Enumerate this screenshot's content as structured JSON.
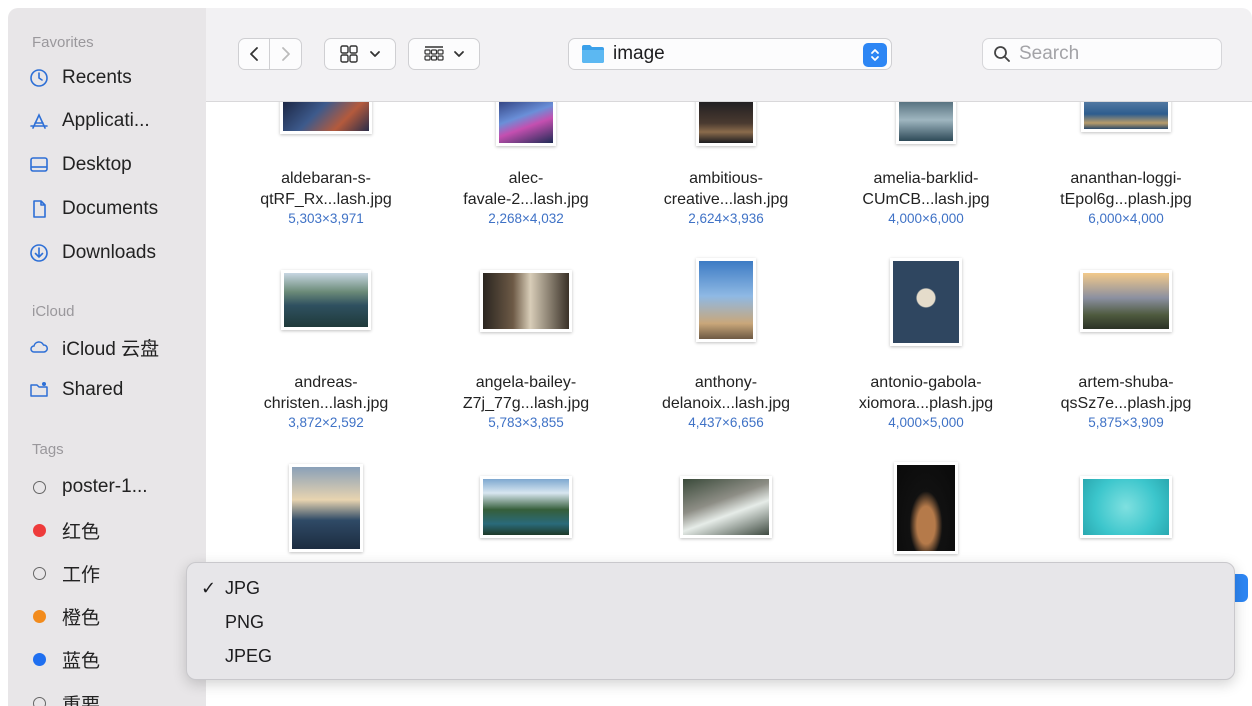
{
  "sidebar": {
    "favorites_label": "Favorites",
    "favorites": [
      {
        "label": "Recents",
        "icon": "clock-icon"
      },
      {
        "label": "Applicati...",
        "icon": "applications-icon"
      },
      {
        "label": "Desktop",
        "icon": "desktop-icon"
      },
      {
        "label": "Documents",
        "icon": "document-icon"
      },
      {
        "label": "Downloads",
        "icon": "download-icon"
      }
    ],
    "icloud_label": "iCloud",
    "icloud": [
      {
        "label": "iCloud 云盘",
        "icon": "cloud-icon"
      },
      {
        "label": "Shared",
        "icon": "shared-folder-icon"
      }
    ],
    "tags_label": "Tags",
    "tags": [
      {
        "label": "poster-1...",
        "color": "none"
      },
      {
        "label": "红色",
        "color": "#ee3b3b"
      },
      {
        "label": "工作",
        "color": "none"
      },
      {
        "label": "橙色",
        "color": "#f28b1c"
      },
      {
        "label": "蓝色",
        "color": "#1f6ff0"
      },
      {
        "label": "重要",
        "color": "none"
      }
    ]
  },
  "toolbar": {
    "location": "image",
    "search_placeholder": "Search"
  },
  "files": [
    {
      "line1": "aldebaran-s-",
      "line2": "qtRF_Rx...lash.jpg",
      "dims": "5,303×3,971"
    },
    {
      "line1": "alec-",
      "line2": "favale-2...lash.jpg",
      "dims": "2,268×4,032"
    },
    {
      "line1": "ambitious-",
      "line2": "creative...lash.jpg",
      "dims": "2,624×3,936"
    },
    {
      "line1": "amelia-barklid-",
      "line2": "CUmCB...lash.jpg",
      "dims": "4,000×6,000"
    },
    {
      "line1": "ananthan-loggi-",
      "line2": "tEpol6g...plash.jpg",
      "dims": "6,000×4,000"
    },
    {
      "line1": "andreas-",
      "line2": "christen...lash.jpg",
      "dims": "3,872×2,592"
    },
    {
      "line1": "angela-bailey-",
      "line2": "Z7j_77g...lash.jpg",
      "dims": "5,783×3,855"
    },
    {
      "line1": "anthony-",
      "line2": "delanoix...lash.jpg",
      "dims": "4,437×6,656"
    },
    {
      "line1": "antonio-gabola-",
      "line2": "xiomora...plash.jpg",
      "dims": "4,000×5,000"
    },
    {
      "line1": "artem-shuba-",
      "line2": "qsSz7e...plash.jpg",
      "dims": "5,875×3,909"
    }
  ],
  "format_menu": {
    "items": [
      "JPG",
      "PNG",
      "JPEG"
    ],
    "selected": "JPG",
    "check_mark": "✓"
  }
}
